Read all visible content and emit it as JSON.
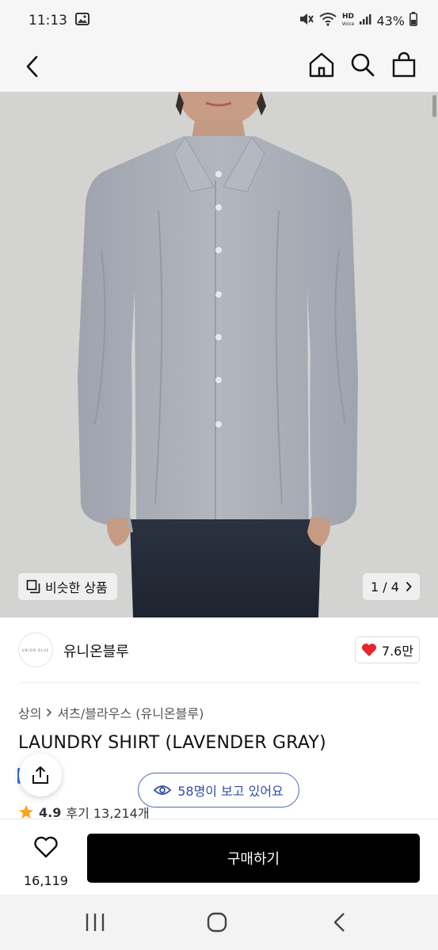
{
  "status_bar": {
    "time": "11:13",
    "battery": "43%",
    "hd_label_top": "HD",
    "hd_label_bottom": "Voice"
  },
  "header": {
    "icons": [
      "back-icon",
      "home-icon",
      "search-icon",
      "shopping-bag-icon"
    ]
  },
  "product_image": {
    "similar_products_label": "비슷한 상품",
    "page_indicator": "1 / 4"
  },
  "brand": {
    "logo_text": "UNION BLUE",
    "name": "유니온블루",
    "likes": "7.6만"
  },
  "breadcrumb": {
    "category": "상의",
    "subcategory": "셔츠/블라우스 (유니온블루)"
  },
  "product": {
    "title": "LAUNDRY SHIRT (LAVENDER GRAY)",
    "viewers_text": "58명이 보고 있어요",
    "rating": "4.9",
    "reviews": "후기 13,214개"
  },
  "action_bar": {
    "wish_count": "16,119",
    "buy_label": "구매하기"
  },
  "colors": {
    "accent_blue": "#2e4fa6",
    "heart_red": "#e6262f",
    "buy_button": "#000000",
    "shirt": "#a9adb6"
  }
}
